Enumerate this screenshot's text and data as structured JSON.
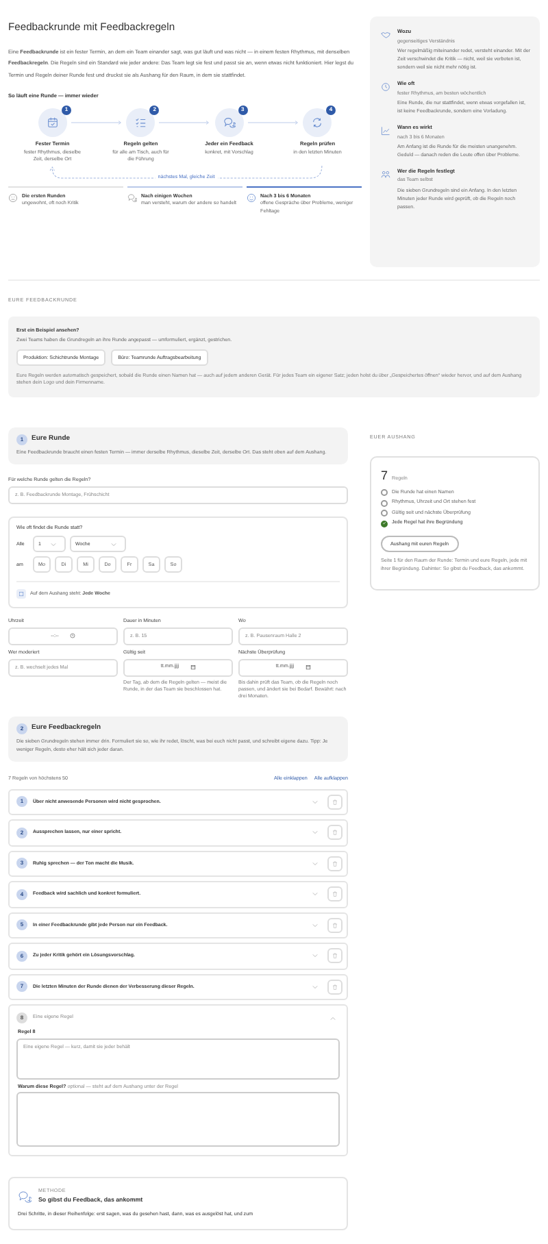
{
  "title": "Feedbackrunde mit Feedbackregeln",
  "intro": "Eine **Feedbackrunde** ist ein fester Termin, an dem ein Team einander sagt, was gut läuft und was nicht — in einem festen Rhythmus, mit denselben **Feedbackregeln**. Die Regeln sind ein Standard wie jeder andere: Das Team legt sie fest und passt sie an, wenn etwas nicht funktioniert. Hier legst du Termin und Regeln deiner Runde fest und druckst sie als Aushang für den Raum, in dem sie stattfindet.",
  "cycle": {
    "heading": "So läuft eine Runde — immer wieder",
    "loop_label": "nächstes Mal, gleiche Zeit",
    "steps": [
      {
        "number": "1",
        "title": "Fester Termin",
        "text": "fester Rhythmus, dieselbe Zeit, derselbe Ort"
      },
      {
        "number": "2",
        "title": "Regeln gelten",
        "text": "für alle am Tisch, auch für die Führung"
      },
      {
        "number": "3",
        "title": "Jeder ein Feedback",
        "text": "konkret, mit Vorschlag"
      },
      {
        "number": "4",
        "title": "Regeln prüfen",
        "text": "in den letzten Minuten"
      }
    ]
  },
  "phases": [
    {
      "title": "Die ersten Runden",
      "text": "ungewohnt, oft noch Kritik",
      "color": "#e2e2e2"
    },
    {
      "title": "Nach einigen Wochen",
      "text": "man versteht, warum der andere so handelt",
      "color": "#b9c9e9"
    },
    {
      "title": "Nach 3 bis 6 Monaten",
      "text": "offene Gespräche über Probleme, weniger Fehltage",
      "color": "#4a72c4"
    }
  ],
  "facts": [
    {
      "title": "Wozu",
      "subtitle": "gegenseitiges Verständnis",
      "text": "Wer regelmäßig miteinander redet, versteht einander. Mit der Zeit verschwindet die Kritik — nicht, weil sie verboten ist, sondern weil sie nicht mehr nötig ist."
    },
    {
      "title": "Wie oft",
      "subtitle": "fester Rhythmus, am besten wöchentlich",
      "text": "Eine Runde, die nur stattfindet, wenn etwas vorgefallen ist, ist keine Feedbackrunde, sondern eine Vorladung."
    },
    {
      "title": "Wann es wirkt",
      "subtitle": "nach 3 bis 6 Monaten",
      "text": "Am Anfang ist die Runde für die meisten unangenehm. Geduld — danach reden die Leute offen über Probleme."
    },
    {
      "title": "Wer die Regeln festlegt",
      "subtitle": "das Team selbst",
      "text": "Die sieben Grundregeln sind ein Anfang. In den letzten Minuten jeder Runde wird geprüft, ob die Regeln noch passen."
    }
  ],
  "section_label": "EURE FEEDBACKRUNDE",
  "examples": {
    "heading": "Erst ein Beispiel ansehen?",
    "text": "Zwei Teams haben die Grundregeln an ihre Runde angepasst — umformuliert, ergänzt, gestrichen.",
    "buttons": [
      "Produktion: Schichtrunde Montage",
      "Büro: Teamrunde Auftragsbearbeitung"
    ],
    "note": "Eure Regeln werden automatisch gespeichert, sobald die Runde einen Namen hat — auch auf jedem anderen Gerät. Für jedes Team ein eigener Satz; jeden holst du über „Gespeichertes öffnen“ wieder hervor, und auf dem Aushang stehen dein Logo und dein Firmenname."
  },
  "section1": {
    "number": "1",
    "title": "Eure Runde",
    "text": "Eine Feedbackrunde braucht einen festen Termin — immer derselbe Rhythmus, dieselbe Zeit, derselbe Ort. Das steht oben auf dem Aushang."
  },
  "name_field": {
    "label": "Für welche Runde gelten die Regeln?",
    "placeholder": "z. B. Feedbackrunde Montage, Frühschicht"
  },
  "frequency": {
    "label": "Wie oft findet die Runde statt?",
    "every_label": "Alle",
    "count": "1",
    "unit": "Woche",
    "on_label": "am",
    "days": [
      {
        "label": "Mo",
        "selected": false
      },
      {
        "label": "Di",
        "selected": false
      },
      {
        "label": "Mi",
        "selected": false
      },
      {
        "label": "Do",
        "selected": false
      },
      {
        "label": "Fr",
        "selected": false
      },
      {
        "label": "Sa",
        "selected": false
      },
      {
        "label": "So",
        "selected": false
      }
    ],
    "summary": "Auf dem Aushang steht: **Jede Woche**"
  },
  "fields": [
    {
      "kind": "time",
      "label": "Uhrzeit",
      "value": "--:--"
    },
    {
      "kind": "text",
      "label": "Dauer in Minuten",
      "placeholder": "z. B. 15"
    },
    {
      "kind": "text",
      "label": "Wo",
      "placeholder": "z. B. Pausenraum Halle 2"
    },
    {
      "kind": "text",
      "label": "Wer moderiert",
      "placeholder": "z. B. wechselt jedes Mal"
    },
    {
      "kind": "date",
      "label": "Gültig seit",
      "value": "tt.mm.jjjj",
      "hint": "Der Tag, ab dem die Regeln gelten — meist die Runde, in der das Team sie beschlossen hat."
    },
    {
      "kind": "date",
      "label": "Nächste Überprüfung",
      "value": "tt.mm.jjjj",
      "hint": "Bis dahin prüft das Team, ob die Regeln noch passen, und ändert sie bei Bedarf. Bewährt: nach drei Monaten."
    }
  ],
  "section2": {
    "number": "2",
    "title": "Eure Feedbackregeln",
    "text": "Die sieben Grundregeln stehen immer drin. Formuliert sie so, wie ihr redet, löscht, was bei euch nicht passt, und schreibt eigene dazu. Tipp: Je weniger Regeln, desto eher hält sich jeder daran."
  },
  "rules_count": "7 Regeln von höchstens 50",
  "collapse_all": "Alle einklappen",
  "expand_all": "Alle aufklappen",
  "rules": [
    {
      "number": "1",
      "text": "Über nicht anwesende Personen wird nicht gesprochen.",
      "expanded": false
    },
    {
      "number": "2",
      "text": "Aussprechen lassen, nur einer spricht.",
      "expanded": false
    },
    {
      "number": "3",
      "text": "Ruhig sprechen — der Ton macht die Musik.",
      "expanded": false
    },
    {
      "number": "4",
      "text": "Feedback wird sachlich und konkret formuliert.",
      "expanded": false
    },
    {
      "number": "5",
      "text": "In einer Feedbackrunde gibt jede Person nur ein Feedback.",
      "expanded": false
    },
    {
      "number": "6",
      "text": "Zu jeder Kritik gehört ein Lösungsvorschlag.",
      "expanded": false
    },
    {
      "number": "7",
      "text": "Die letzten Minuten der Runde dienen der Verbesserung dieser Regeln.",
      "expanded": false
    }
  ],
  "custom_rule": {
    "number": "8",
    "title": "Eine eigene Regel",
    "expanded": true,
    "rule_label": "Regel 8",
    "rule_placeholder": "Eine eigene Regel — kurz, damit sie jeder behält",
    "reason_label": "Warum diese Regel?",
    "reason_hint": "optional — steht auf dem Aushang unter der Regel"
  },
  "method": {
    "eyebrow": "METHODE",
    "title": "So gibst du Feedback, das ankommt",
    "text": "Drei Schritte, in dieser Reihenfolge: erst sagen, was du gesehen hast, dann, was es ausgelöst hat, und zum"
  },
  "poster": {
    "label": "EUER AUSHANG",
    "count": "7",
    "count_label": "Regeln",
    "checks": [
      {
        "label": "Die Runde hat einen Namen",
        "checked": false
      },
      {
        "label": "Rhythmus, Uhrzeit und Ort stehen fest",
        "checked": false
      },
      {
        "label": "Gültig seit und nächste Überprüfung",
        "checked": false
      },
      {
        "label": "Jede Regel hat ihre Begründung",
        "checked": true
      }
    ],
    "button": "Aushang mit euren Regeln",
    "note": "Seite 1 für den Raum der Runde: Termin und eure Regeln, jede mit ihrer Begründung. Dahinter: So gibst du Feedback, das ankommt."
  }
}
